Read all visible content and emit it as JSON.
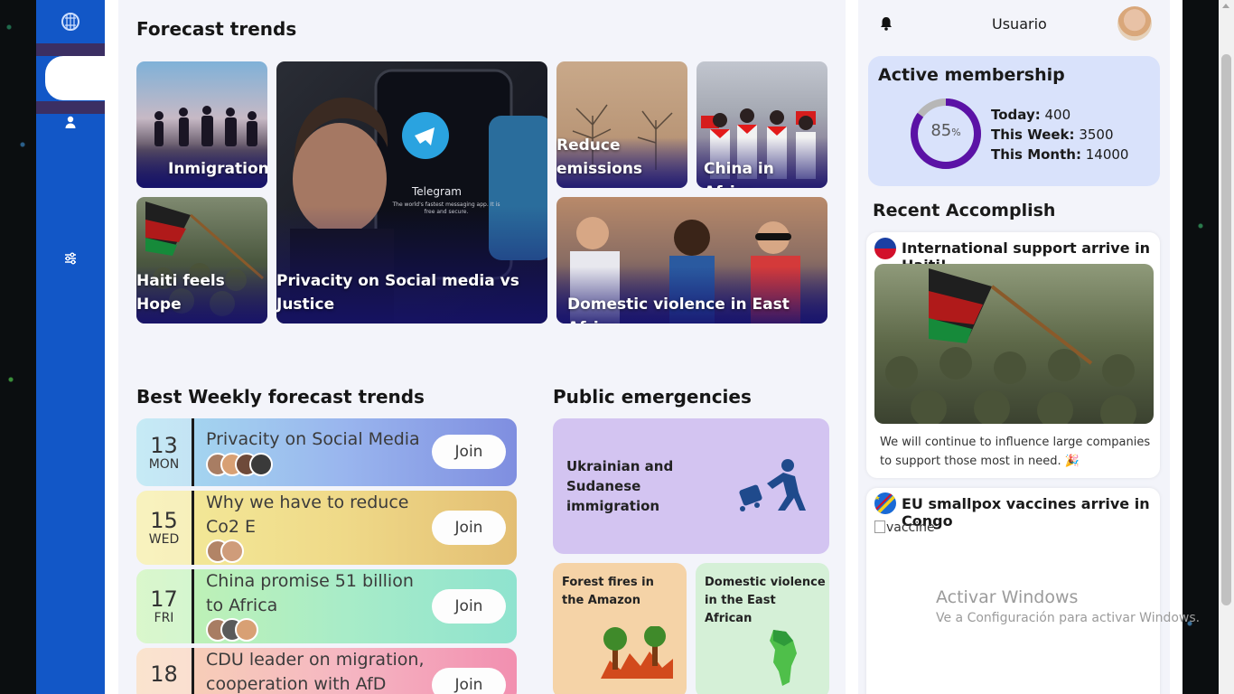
{
  "user": {
    "name": "Usuario"
  },
  "forecast": {
    "title": "Forecast trends",
    "tiles": [
      "Inmigration",
      "Privacity on Social media vs Justice",
      "Reduce emissions",
      "China in Africa",
      "Haiti feels Hope",
      "Domestic violence in East Africa"
    ],
    "telegram": {
      "brand": "Telegram",
      "tagline": "The world's fastest messaging app. It is free and secure."
    }
  },
  "weekly": {
    "title": "Best Weekly forecast trends",
    "join_label": "Join",
    "items": [
      {
        "day": "13",
        "dow": "MON",
        "title": "Privacity on Social Media"
      },
      {
        "day": "15",
        "dow": "WED",
        "title": "Why we have to reduce Co2 E"
      },
      {
        "day": "17",
        "dow": "FRI",
        "title": "China promise 51 billion to Africa"
      },
      {
        "day": "18",
        "dow": "",
        "title": "CDU leader on migration, cooperation with AfD"
      }
    ]
  },
  "emergencies": {
    "title": "Public emergencies",
    "items": [
      "Ukrainian and Sudanese immigration",
      "Forest fires in the Amazon",
      "Domestic violence in the East African"
    ]
  },
  "membership": {
    "title": "Active membership",
    "percent_value": 85,
    "percent": "85",
    "percent_unit": "%",
    "today_label": "Today:",
    "today": "400",
    "week_label": "This Week:",
    "week": "3500",
    "month_label": "This Month:",
    "month": "14000"
  },
  "recent": {
    "title": "Recent Accomplish",
    "items": [
      {
        "title": "International support arrive in Haiti!",
        "text": "We will continue to influence large companies to support those most in need."
      },
      {
        "title": "EU smallpox vaccines arrive in Congo",
        "img_alt": "vaccine"
      }
    ]
  },
  "watermark": {
    "line1": "Activar Windows",
    "line2": "Ve a Configuración para activar Windows."
  },
  "colors": {
    "sidebar": "#1257c7",
    "accent_purple": "#5b12a6",
    "page_bg": "#f3f4fa"
  }
}
